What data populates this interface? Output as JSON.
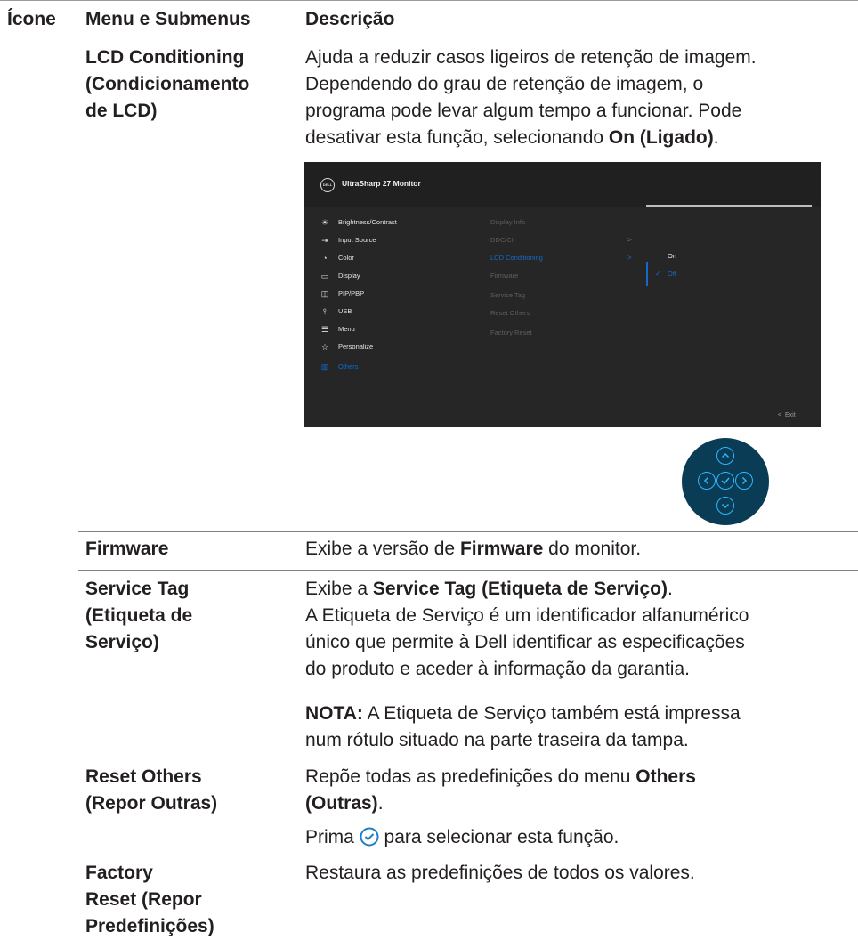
{
  "header": {
    "col_icon": "Ícone",
    "col_menu": "Menu e Submenus",
    "col_desc": "Descrição"
  },
  "rows": {
    "lcd": {
      "name": [
        "LCD Conditioning",
        "(Condicionamento",
        "de LCD)"
      ],
      "desc_lines": [
        "Ajuda a reduzir casos ligeiros de retenção de imagem.",
        "Dependendo do grau de retenção de imagem, o",
        "programa pode levar algum tempo a funcionar. Pode"
      ],
      "desc_last_prefix": "desativar esta função, selecionando ",
      "desc_last_bold": "On (Ligado)",
      "desc_last_suffix": "."
    },
    "firmware": {
      "name": "Firmware",
      "desc_prefix": "Exibe a versão de ",
      "desc_bold": "Firmware",
      "desc_suffix": " do monitor."
    },
    "service_tag": {
      "name": [
        "Service Tag",
        "(Etiqueta de",
        "Serviço)"
      ],
      "desc_prefix": "Exibe a ",
      "desc_bold": "Service Tag (Etiqueta de Serviço)",
      "desc_suffix": ".",
      "desc_lines": [
        "A Etiqueta de Serviço é um identificador alfanumérico",
        "único que permite à Dell identificar as especificações",
        "do produto e aceder à informação da garantia."
      ],
      "note_label": "NOTA:",
      "note_line1": " A Etiqueta de Serviço também está impressa",
      "note_line2": "num rótulo situado na parte traseira da tampa."
    },
    "reset_others": {
      "name": [
        "Reset Others",
        "(Repor Outras)"
      ],
      "desc_prefix": "Repõe todas as predefinições do menu ",
      "desc_bold1": "Others",
      "desc_bold2": "(Outras)",
      "desc_suffix": ".",
      "press_prefix": "Prima ",
      "press_suffix": " para selecionar esta função."
    },
    "factory_reset": {
      "name": [
        "Factory",
        "Reset (Repor",
        "Predefinições)"
      ],
      "desc": "Restaura as predefinições de todos os valores."
    }
  },
  "osd": {
    "logo": "DELL",
    "title": "UltraSharp 27 Monitor",
    "menu": [
      {
        "icon": "brightness-icon",
        "glyph": "☀",
        "label": "Brightness/Contrast"
      },
      {
        "icon": "input-source-icon",
        "glyph": "⇥",
        "label": "Input Source"
      },
      {
        "icon": "color-icon",
        "glyph": "◔",
        "label": "Color"
      },
      {
        "icon": "display-icon",
        "glyph": "▭",
        "label": "Display"
      },
      {
        "icon": "pip-pbp-icon",
        "glyph": "◫",
        "label": "PIP/PBP"
      },
      {
        "icon": "usb-icon",
        "glyph": "⫯",
        "label": "USB"
      },
      {
        "icon": "menu-icon",
        "glyph": "☰",
        "label": "Menu"
      },
      {
        "icon": "personalize-icon",
        "glyph": "☆",
        "label": "Personalize"
      },
      {
        "icon": "others-icon",
        "glyph": "▥",
        "label": "Others"
      }
    ],
    "submenu": [
      "Display Info",
      "DDC/CI",
      "LCD Conditioning",
      "Firmware",
      "Service Tag",
      "Reset Others",
      "Factory Reset"
    ],
    "options": [
      "On",
      "Off"
    ],
    "exit": "Exit"
  },
  "colors": {
    "osd_bg": "#262626",
    "accent": "#1569c9",
    "joystick_bg": "#0a3c56",
    "joystick_ring": "#2bb7ff"
  }
}
